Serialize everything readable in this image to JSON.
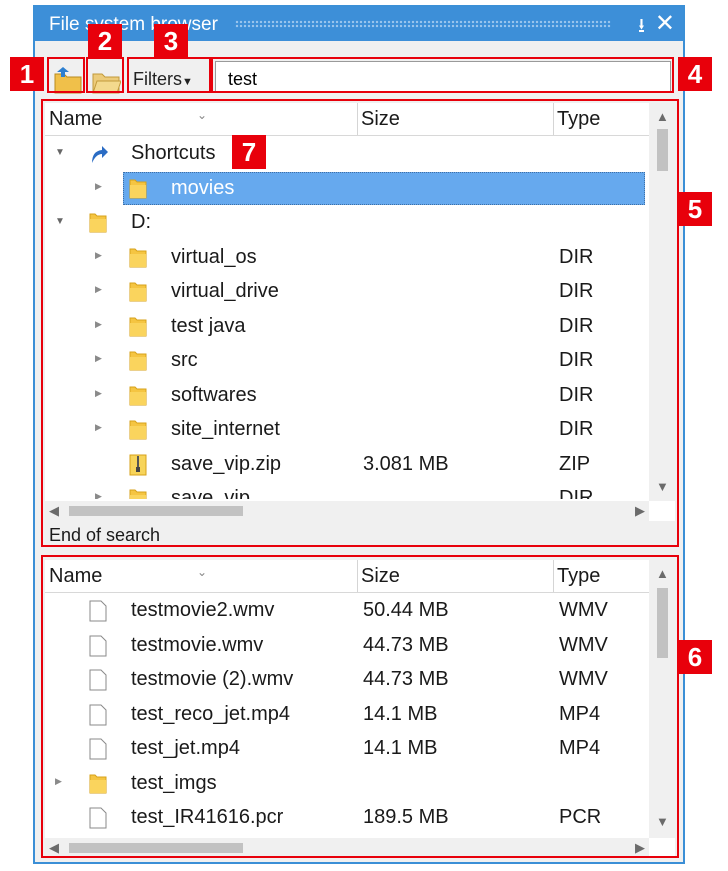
{
  "window": {
    "title": "File system browser",
    "pin_glyph": "⭳",
    "close_glyph": "✕"
  },
  "toolbar": {
    "filters_label": "Filters",
    "search_value": "test"
  },
  "tree": {
    "columns": {
      "name": "Name",
      "size": "Size",
      "type": "Type"
    },
    "rows": [
      {
        "name": "Shortcuts",
        "size": "",
        "type": "",
        "icon": "shortcut-icon",
        "expander": "expanded",
        "level": 0
      },
      {
        "name": "movies",
        "size": "",
        "type": "",
        "icon": "folder-icon",
        "expander": "collapsed",
        "level": 1,
        "selected": true
      },
      {
        "name": "D:",
        "size": "",
        "type": "",
        "icon": "folder-icon",
        "expander": "expanded",
        "level": 0
      },
      {
        "name": "virtual_os",
        "size": "",
        "type": "DIR",
        "icon": "folder-icon",
        "expander": "collapsed",
        "level": 1
      },
      {
        "name": "virtual_drive",
        "size": "",
        "type": "DIR",
        "icon": "folder-icon",
        "expander": "collapsed",
        "level": 1
      },
      {
        "name": "test java",
        "size": "",
        "type": "DIR",
        "icon": "folder-icon",
        "expander": "collapsed",
        "level": 1
      },
      {
        "name": "src",
        "size": "",
        "type": "DIR",
        "icon": "folder-icon",
        "expander": "collapsed",
        "level": 1
      },
      {
        "name": "softwares",
        "size": "",
        "type": "DIR",
        "icon": "folder-icon",
        "expander": "collapsed",
        "level": 1
      },
      {
        "name": "site_internet",
        "size": "",
        "type": "DIR",
        "icon": "folder-icon",
        "expander": "collapsed",
        "level": 1
      },
      {
        "name": "save_vip.zip",
        "size": "3.081 MB",
        "type": "ZIP",
        "icon": "zip-icon",
        "expander": "none",
        "level": 1
      },
      {
        "name": "save_vip",
        "size": "",
        "type": "DIR",
        "icon": "folder-icon",
        "expander": "collapsed",
        "level": 1
      }
    ],
    "status": "End of search"
  },
  "results": {
    "columns": {
      "name": "Name",
      "size": "Size",
      "type": "Type"
    },
    "rows": [
      {
        "name": "testmovie2.wmv",
        "size": "50.44 MB",
        "type": "WMV",
        "icon": "file-icon",
        "expander": "none"
      },
      {
        "name": "testmovie.wmv",
        "size": "44.73 MB",
        "type": "WMV",
        "icon": "file-icon",
        "expander": "none"
      },
      {
        "name": "testmovie (2).wmv",
        "size": "44.73 MB",
        "type": "WMV",
        "icon": "file-icon",
        "expander": "none"
      },
      {
        "name": "test_reco_jet.mp4",
        "size": "14.1 MB",
        "type": "MP4",
        "icon": "file-icon",
        "expander": "none"
      },
      {
        "name": "test_jet.mp4",
        "size": "14.1 MB",
        "type": "MP4",
        "icon": "file-icon",
        "expander": "none"
      },
      {
        "name": "test_imgs",
        "size": "",
        "type": "",
        "icon": "folder-icon",
        "expander": "collapsed"
      },
      {
        "name": "test_IR41616.pcr",
        "size": "189.5 MB",
        "type": "PCR",
        "icon": "file-icon",
        "expander": "none"
      }
    ]
  },
  "callouts": [
    "1",
    "2",
    "3",
    "4",
    "5",
    "6",
    "7"
  ],
  "colors": {
    "titlebar": "#3d8fd8",
    "selection": "#66a9ee",
    "callout": "#e8000b",
    "folder": "#f5c542"
  }
}
